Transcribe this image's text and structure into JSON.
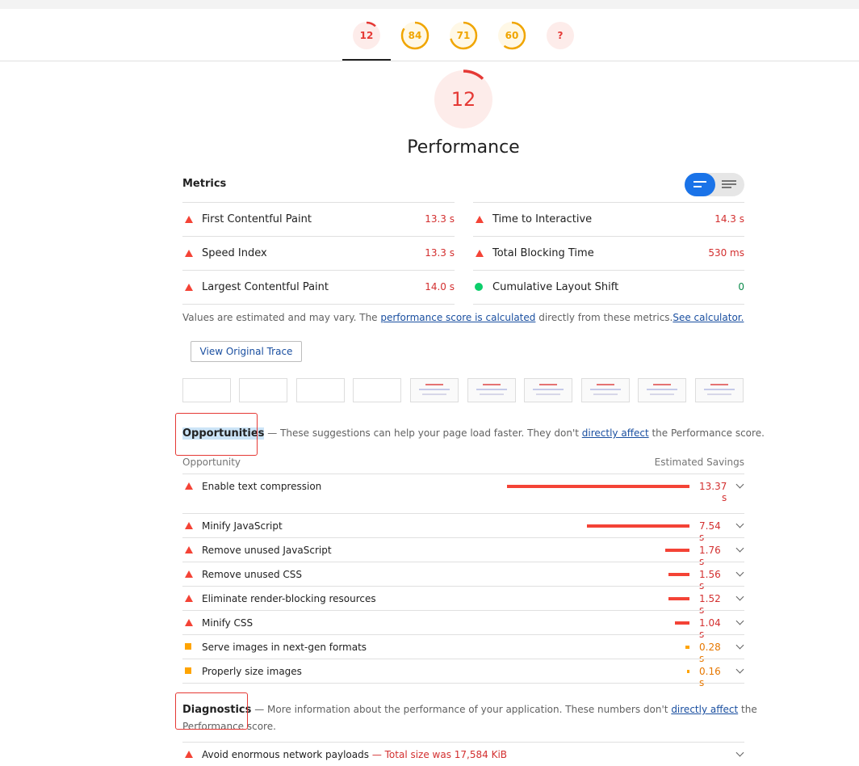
{
  "tabs": [
    {
      "score": "12",
      "color": "#e53935",
      "fill": "#fdecea",
      "fraction": 0.12
    },
    {
      "score": "84",
      "color": "#f0a500",
      "fill": "#fff8e6",
      "fraction": 0.84
    },
    {
      "score": "71",
      "color": "#f0a500",
      "fill": "#fff8e6",
      "fraction": 0.71
    },
    {
      "score": "60",
      "color": "#f0a500",
      "fill": "#fff8e6",
      "fraction": 0.6
    },
    {
      "score": "?",
      "color": "#e53935",
      "fill": "#fdecea",
      "fraction": 0
    }
  ],
  "category": {
    "score": "12",
    "title": "Performance",
    "fraction": 0.12,
    "color": "#e53935"
  },
  "metrics": {
    "title": "Metrics",
    "left": [
      {
        "label": "First Contentful Paint",
        "value": "13.3 s",
        "status": "fail"
      },
      {
        "label": "Speed Index",
        "value": "13.3 s",
        "status": "fail"
      },
      {
        "label": "Largest Contentful Paint",
        "value": "14.0 s",
        "status": "fail"
      }
    ],
    "right": [
      {
        "label": "Time to Interactive",
        "value": "14.3 s",
        "status": "fail"
      },
      {
        "label": "Total Blocking Time",
        "value": "530 ms",
        "status": "fail"
      },
      {
        "label": "Cumulative Layout Shift",
        "value": "0",
        "status": "pass"
      }
    ]
  },
  "estimate": {
    "prefix": "Values are estimated and may vary. The ",
    "link1": "performance score is calculated",
    "middle": " directly from these metrics.",
    "link2": "See calculator."
  },
  "trace_button": "View Original Trace",
  "opportunities": {
    "title": "Opportunities",
    "separator": " — ",
    "desc_prefix": "These suggestions can help your page load faster. They don't ",
    "desc_link": "directly affect",
    "desc_suffix": " the Performance score.",
    "col_left": "Opportunity",
    "col_right": "Estimated Savings",
    "items": [
      {
        "label": "Enable text compression",
        "savings_line1": "13.37",
        "savings_line2": "s",
        "seconds": 13.37,
        "status": "fail"
      },
      {
        "label": "Minify JavaScript",
        "savings": "7.54 s",
        "seconds": 7.54,
        "status": "fail"
      },
      {
        "label": "Remove unused JavaScript",
        "savings": "1.76 s",
        "seconds": 1.76,
        "status": "fail"
      },
      {
        "label": "Remove unused CSS",
        "savings": "1.56 s",
        "seconds": 1.56,
        "status": "fail"
      },
      {
        "label": "Eliminate render-blocking resources",
        "savings": "1.52 s",
        "seconds": 1.52,
        "status": "fail"
      },
      {
        "label": "Minify CSS",
        "savings": "1.04 s",
        "seconds": 1.04,
        "status": "fail"
      },
      {
        "label": "Serve images in next-gen formats",
        "savings": "0.28 s",
        "seconds": 0.28,
        "status": "warn"
      },
      {
        "label": "Properly size images",
        "savings": "0.16 s",
        "seconds": 0.16,
        "status": "warn"
      }
    ]
  },
  "diagnostics": {
    "title": "Diagnostics",
    "separator": " — ",
    "desc_prefix": "More information about the performance of your application. These numbers don't ",
    "desc_link": "directly affect",
    "desc_suffix_1": " the",
    "desc_line2": "Performance score.",
    "items": [
      {
        "label": "Avoid enormous network payloads",
        "extra": " — Total size was 17,584 KiB"
      }
    ]
  }
}
